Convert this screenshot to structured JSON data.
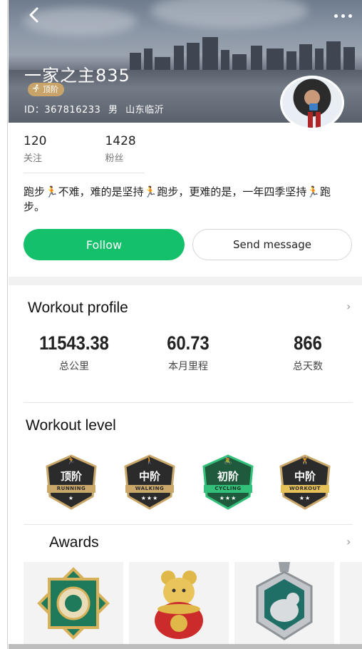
{
  "header": {
    "username": "一家之主835",
    "rank_label": "顶阶",
    "id_text": "ID：367816233",
    "gender": "男",
    "location": "山东临沂"
  },
  "stats": [
    {
      "value": "120",
      "label": "关注"
    },
    {
      "value": "1428",
      "label": "粉丝"
    }
  ],
  "bio": "跑步🏃不难，难的是坚持🏃跑步，更难的是，一年四季坚持🏃跑步。",
  "actions": {
    "follow_label": "Follow",
    "message_label": "Send message",
    "accent_color": "#14c06a"
  },
  "workout_profile": {
    "title": "Workout profile",
    "metrics": [
      {
        "value": "11543.38",
        "label": "总公里"
      },
      {
        "value": "60.73",
        "label": "本月里程"
      },
      {
        "value": "866",
        "label": "总天数"
      }
    ]
  },
  "workout_level": {
    "title": "Workout level",
    "levels": [
      {
        "cn": "顶阶",
        "en": "RUNNING",
        "stars": 1,
        "icon": "runner-icon",
        "color": "#2b2b2b"
      },
      {
        "cn": "中阶",
        "en": "WALKING",
        "stars": 3,
        "icon": "walker-icon",
        "color": "#2b2b2b"
      },
      {
        "cn": "初阶",
        "en": "CYCLING",
        "stars": 3,
        "icon": "cyclist-icon",
        "color": "#1f5a3c"
      },
      {
        "cn": "中阶",
        "en": "WORKOUT",
        "stars": 2,
        "icon": "weightlifter-icon",
        "color": "#2b2b2b"
      }
    ]
  },
  "awards": {
    "title": "Awards",
    "items": [
      "green-medal-icon",
      "golden-rat-medal-icon",
      "silver-dog-medal-icon"
    ]
  }
}
